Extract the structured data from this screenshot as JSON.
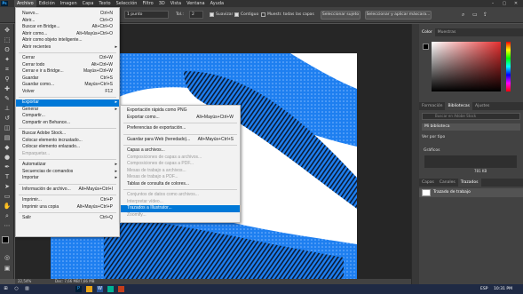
{
  "menubar": {
    "logo": "Ps",
    "items": [
      "Archivo",
      "Edición",
      "Imagen",
      "Capa",
      "Texto",
      "Selección",
      "Filtro",
      "3D",
      "Vista",
      "Ventana",
      "Ayuda"
    ],
    "window_controls": [
      "–",
      "▢",
      "✕"
    ]
  },
  "options": {
    "feather_value": "1 punto",
    "width_label": "Tol.:",
    "width_value": "2",
    "antialias_label": "Suavizar",
    "contiguous_label": "Contiguo",
    "all_layers_label": "Muestr. todas las capas",
    "select_subject_label": "Seleccionar sujeto",
    "select_mask_label": "Seleccionar y aplicar máscara..."
  },
  "status": {
    "zoom": "22,54%",
    "doc_size": "Doc: 7,66 MB/7,66 MB"
  },
  "file_menu": [
    {
      "label": "Nuevo...",
      "shortcut": "Ctrl+N"
    },
    {
      "label": "Abrir...",
      "shortcut": "Ctrl+O"
    },
    {
      "label": "Buscar en Bridge...",
      "shortcut": "Alt+Ctrl+O"
    },
    {
      "label": "Abrir como...",
      "shortcut": "Alt+Mayús+Ctrl+O"
    },
    {
      "label": "Abrir como objeto inteligente...",
      "shortcut": ""
    },
    {
      "label": "Abrir recientes",
      "shortcut": "",
      "submenu": true
    },
    {
      "label": "Cerrar",
      "shortcut": "Ctrl+W"
    },
    {
      "label": "Cerrar todo",
      "shortcut": "Alt+Ctrl+W"
    },
    {
      "label": "Cerrar e ir a Bridge...",
      "shortcut": "Mayús+Ctrl+W"
    },
    {
      "label": "Guardar",
      "shortcut": "Ctrl+S"
    },
    {
      "label": "Guardar como...",
      "shortcut": "Mayús+Ctrl+S"
    },
    {
      "label": "Volver",
      "shortcut": "F12"
    },
    {
      "label": "Exportar",
      "shortcut": "",
      "submenu": true,
      "highlight": true
    },
    {
      "label": "Generar",
      "shortcut": "",
      "submenu": true
    },
    {
      "label": "Compartir...",
      "shortcut": ""
    },
    {
      "label": "Compartir en Behance...",
      "shortcut": ""
    },
    {
      "label": "Buscar Adobe Stock...",
      "shortcut": ""
    },
    {
      "label": "Colocar elemento incrustado...",
      "shortcut": ""
    },
    {
      "label": "Colocar elemento enlazado...",
      "shortcut": ""
    },
    {
      "label": "Empaquetar...",
      "shortcut": "",
      "disabled": true
    },
    {
      "label": "Automatizar",
      "shortcut": "",
      "submenu": true
    },
    {
      "label": "Secuencias de comandos",
      "shortcut": "",
      "submenu": true
    },
    {
      "label": "Importar",
      "shortcut": "",
      "submenu": true
    },
    {
      "label": "Información de archivo...",
      "shortcut": "Alt+Mayús+Ctrl+I"
    },
    {
      "label": "Imprimir...",
      "shortcut": "Ctrl+P"
    },
    {
      "label": "Imprimir una copia",
      "shortcut": "Alt+Mayús+Ctrl+P"
    },
    {
      "label": "Salir",
      "shortcut": "Ctrl+Q"
    }
  ],
  "export_menu": [
    {
      "label": "Exportación rápida como PNG",
      "shortcut": ""
    },
    {
      "label": "Exportar como...",
      "shortcut": "Alt+Mayús+Ctrl+W"
    },
    {
      "label": "Preferencias de exportación...",
      "shortcut": ""
    },
    {
      "label": "Guardar para Web (heredado)...",
      "shortcut": "Alt+Mayús+Ctrl+S"
    },
    {
      "label": "Capas a archivos...",
      "shortcut": ""
    },
    {
      "label": "Composiciones de capas a archivos...",
      "shortcut": "",
      "disabled": true
    },
    {
      "label": "Composiciones de capas a PDF...",
      "shortcut": "",
      "disabled": true
    },
    {
      "label": "Mesas de trabajo a archivos...",
      "shortcut": "",
      "disabled": true
    },
    {
      "label": "Mesas de trabajo a PDF...",
      "shortcut": "",
      "disabled": true
    },
    {
      "label": "Tablas de consulta de colores...",
      "shortcut": ""
    },
    {
      "label": "Conjuntos de datos como archivos...",
      "shortcut": "",
      "disabled": true
    },
    {
      "label": "Interpretar vídeo...",
      "shortcut": "",
      "disabled": true
    },
    {
      "label": "Trazados a Illustrator...",
      "shortcut": "",
      "highlight": true
    },
    {
      "label": "Zoomify...",
      "shortcut": "",
      "disabled": true
    }
  ],
  "panels": {
    "color_tabs": [
      "Color",
      "Muestras"
    ],
    "library_tabs": [
      "Formación",
      "Bibliotecas",
      "Ajustes"
    ],
    "library_search": "Buscar en Adobe Stock",
    "library_name": "Mi biblioteca",
    "view_by": "Ver por tipo",
    "graphics_label": "Gráficos",
    "kb_label": "781 KB",
    "layers_tabs": [
      "Capas",
      "Canales",
      "Trazados"
    ],
    "path_name": "Trazado de trabajo"
  },
  "taskbar": {
    "lang": "ESP",
    "time": "10:31 PM"
  },
  "colors": {
    "menu_bg": "#f2f2f2",
    "highlight": "#0078d7",
    "dot_blue": "#1e7ff0"
  }
}
